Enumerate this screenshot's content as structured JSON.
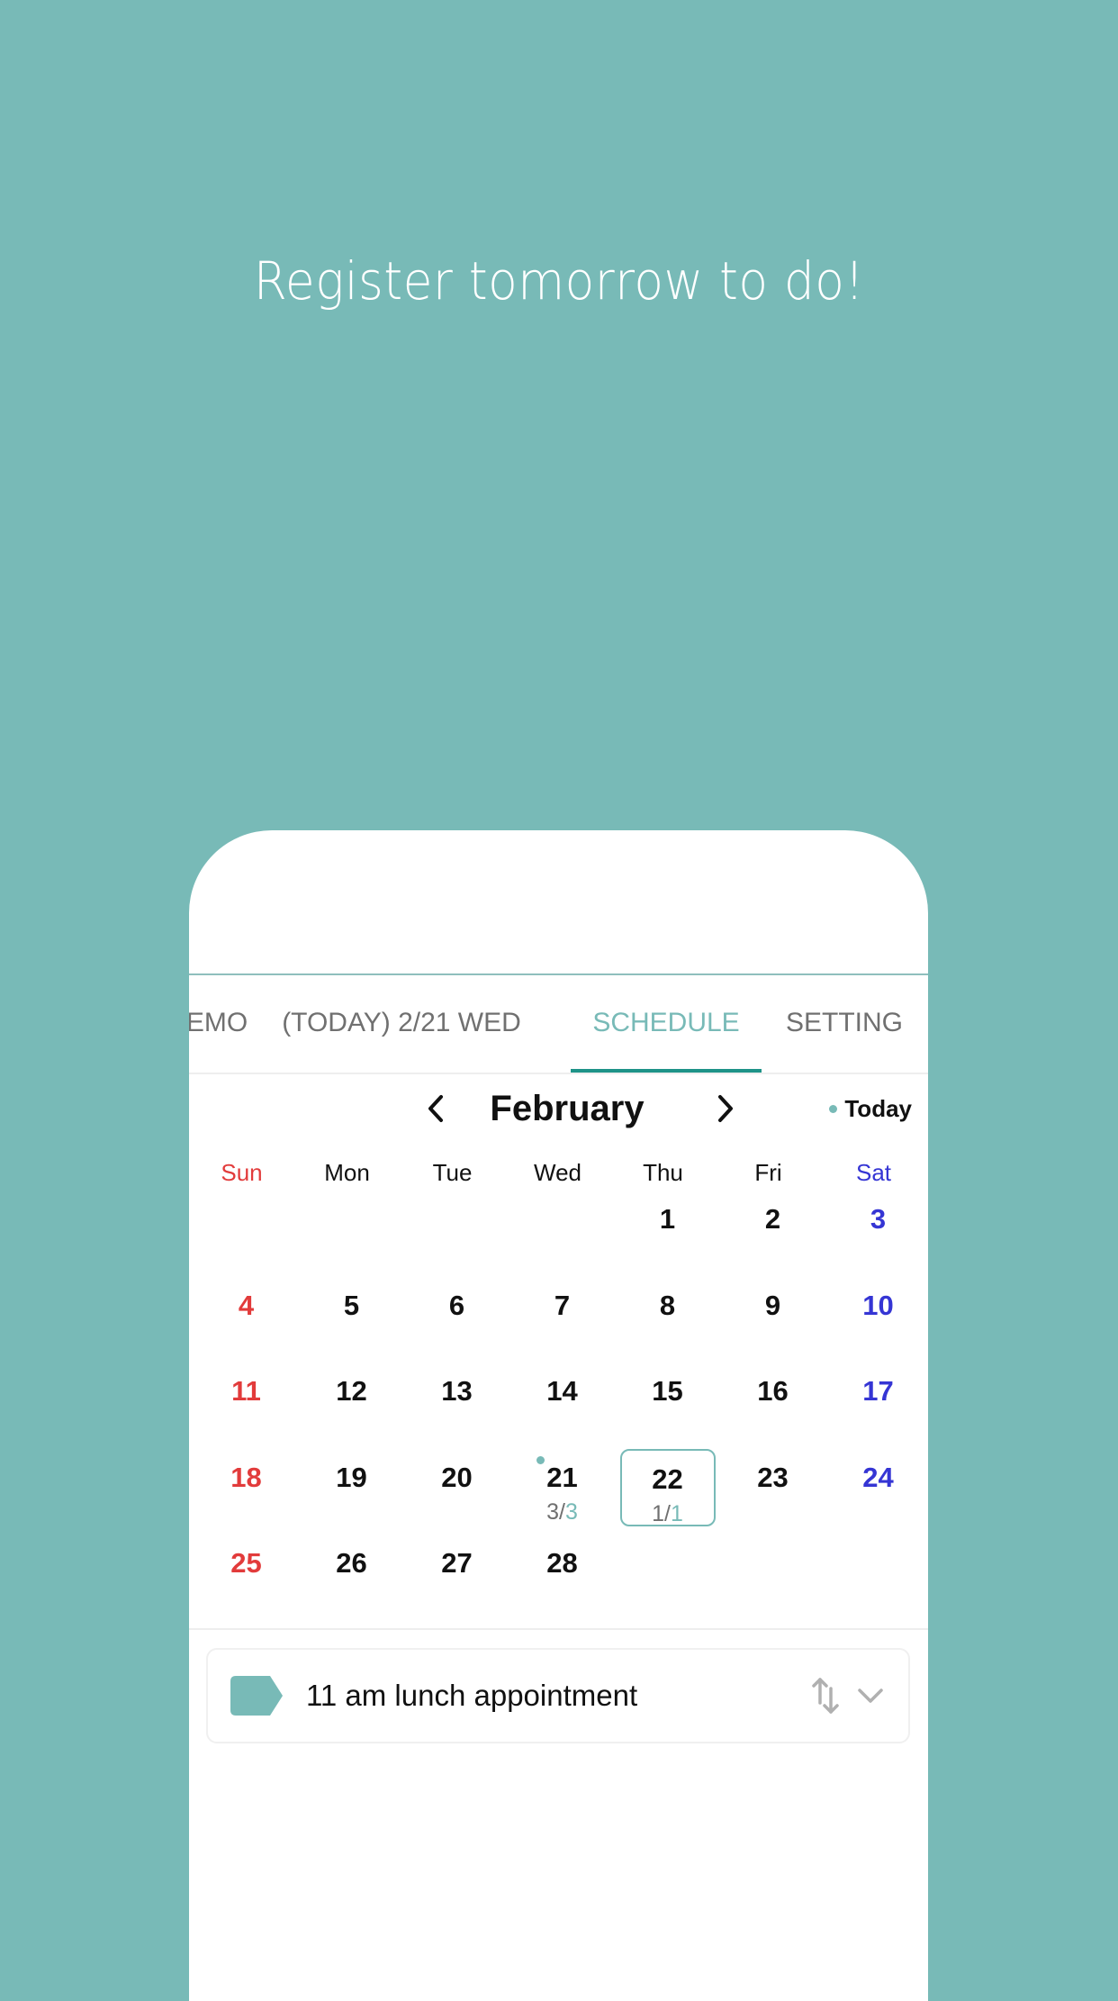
{
  "headline": "Register tomorrow to do!",
  "colors": {
    "background": "#78bab7",
    "accent": "#78bab7",
    "tab_underline": "#1e9388",
    "sunday": "#e23b3b",
    "saturday": "#3535d4"
  },
  "tabs": [
    {
      "label": "EMO",
      "active": false
    },
    {
      "label": "(TODAY) 2/21 WED",
      "active": false
    },
    {
      "label": "SCHEDULE",
      "active": true
    },
    {
      "label": "SETTING",
      "active": false
    }
  ],
  "calendar": {
    "month": "February",
    "prev_icon": "chevron-left-icon",
    "next_icon": "chevron-right-icon",
    "today_label": "Today",
    "weekdays": [
      "Sun",
      "Mon",
      "Tue",
      "Wed",
      "Thu",
      "Fri",
      "Sat"
    ],
    "first_weekday_index": 4,
    "days_in_month": 28,
    "today": 21,
    "selected": 22,
    "counts": {
      "21": {
        "total": "3",
        "done": "3"
      },
      "22": {
        "total": "1",
        "done": "1"
      }
    }
  },
  "tasks": [
    {
      "text": "11 am lunch appointment",
      "tag_icon": "label-tag-icon",
      "reorder_icon": "sort-arrows-icon",
      "expand_icon": "chevron-down-icon"
    }
  ]
}
